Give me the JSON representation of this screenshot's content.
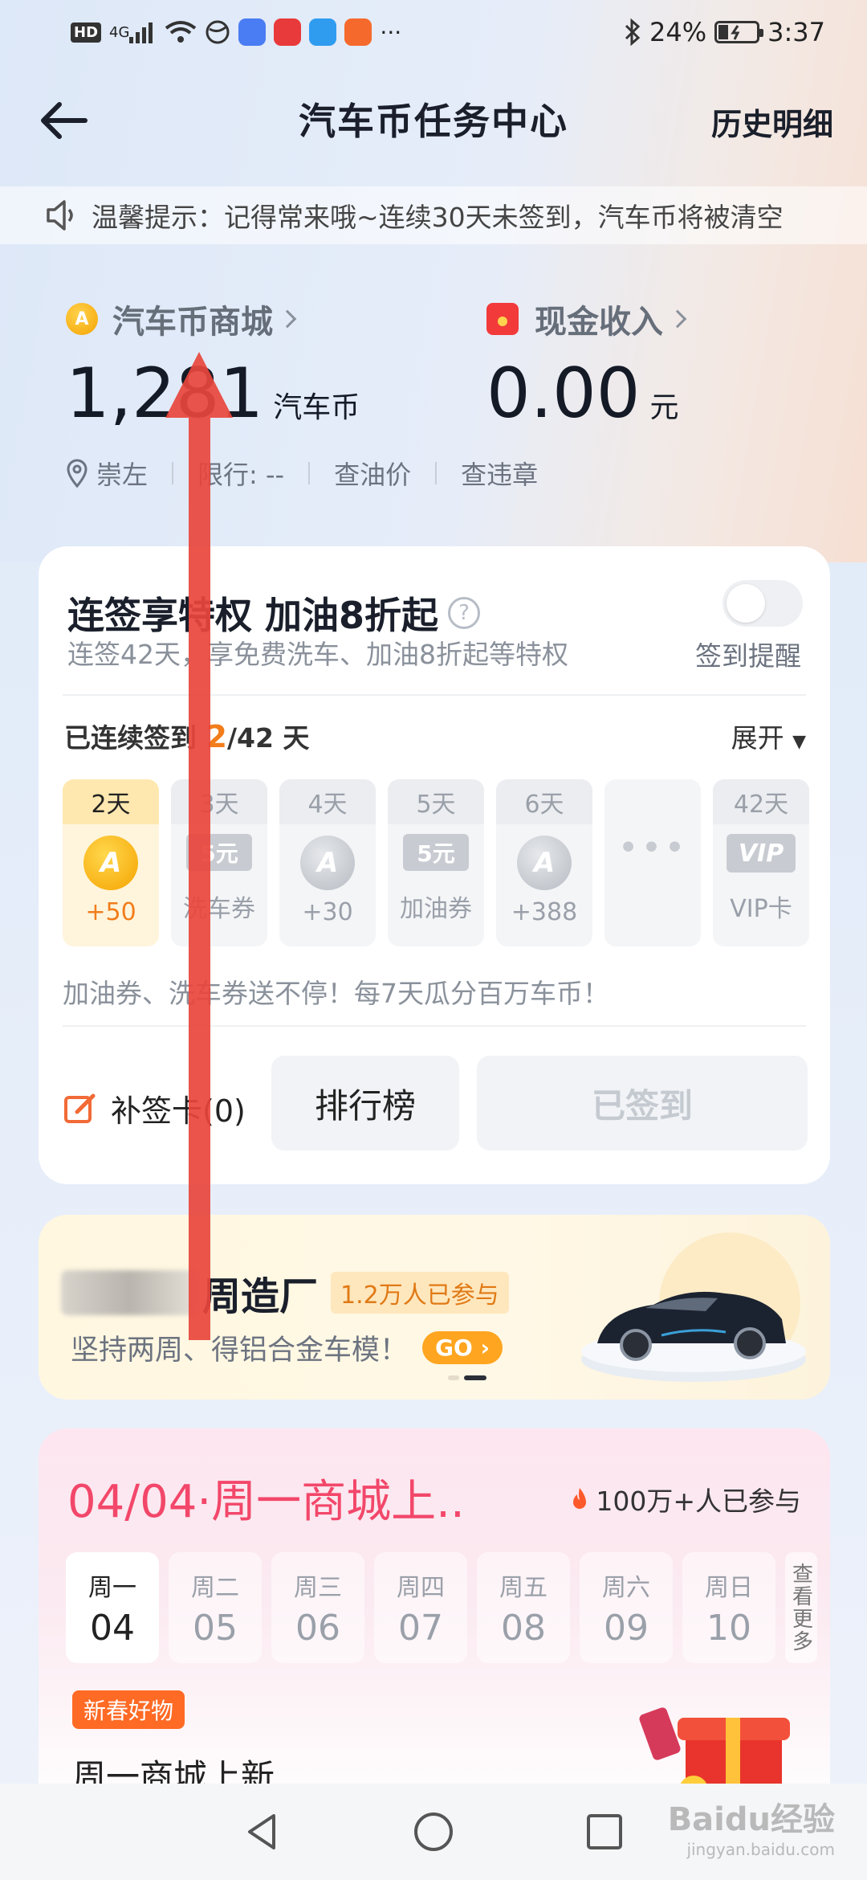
{
  "status_bar": {
    "network": "4G",
    "battery": "24%",
    "time": "3:37"
  },
  "header": {
    "title": "汽车币任务中心",
    "history": "历史明细"
  },
  "notice": {
    "text": "温馨提示：记得常来哦~连续30天未签到，汽车币将被清空"
  },
  "wallet": {
    "coin_mall_label": "汽车币商城",
    "coin_amount": "1,281",
    "coin_unit": "汽车币",
    "cash_label": "现金收入",
    "cash_amount": "0.00",
    "cash_unit": "元"
  },
  "location_bar": {
    "city": "崇左",
    "restriction": "限行: --",
    "oil_price": "查油价",
    "violation": "查违章"
  },
  "signin_card": {
    "title": "连签享特权 加油8折起",
    "subtitle": "连签42天，享免费洗车、加油8折起等特权",
    "remind_label": "签到提醒",
    "streak_prefix": "已连续签到",
    "streak_days": "2",
    "streak_total": "/42 天",
    "expand_label": "展开",
    "days": [
      {
        "label": "2天",
        "value": "+50",
        "reward": "coin"
      },
      {
        "label": "3天",
        "value": "洗车券",
        "reward": "ticket",
        "ticket_text": "5元"
      },
      {
        "label": "4天",
        "value": "+30",
        "reward": "coin"
      },
      {
        "label": "5天",
        "value": "加油券",
        "reward": "ticket",
        "ticket_text": "5元"
      },
      {
        "label": "6天",
        "value": "+388",
        "reward": "coin"
      },
      {
        "label": "",
        "value": "",
        "reward": "more"
      },
      {
        "label": "42天",
        "value": "VIP卡",
        "reward": "vip",
        "ticket_text": "VIP"
      }
    ],
    "promo_text": "加油券、洗车券送不停！每7天瓜分百万车币！",
    "makeup_label": "补签卡(0)",
    "rank_label": "排行榜",
    "signed_label": "已签到"
  },
  "banner": {
    "title": "周造厂",
    "participants": "1.2万人已参与",
    "subtitle": "坚持两周、得铝合金车模！",
    "go_label": "GO"
  },
  "mall_card": {
    "title": "04/04·周一商城上..",
    "participants": "100万+人已参与",
    "weekdays": [
      {
        "name": "周一",
        "num": "04"
      },
      {
        "name": "周二",
        "num": "05"
      },
      {
        "name": "周三",
        "num": "06"
      },
      {
        "name": "周四",
        "num": "07"
      },
      {
        "name": "周五",
        "num": "08"
      },
      {
        "name": "周六",
        "num": "09"
      },
      {
        "name": "周日",
        "num": "10"
      }
    ],
    "more_label": "查看更多",
    "tag": "新春好物",
    "item_title": "周一商城上新"
  },
  "watermark": {
    "brand": "Baidu经验",
    "url": "jingyan.baidu.com"
  },
  "colors": {
    "accent_orange": "#f27d1b",
    "accent_pink": "#f2476a",
    "annotation_arrow": "#e8453c"
  }
}
